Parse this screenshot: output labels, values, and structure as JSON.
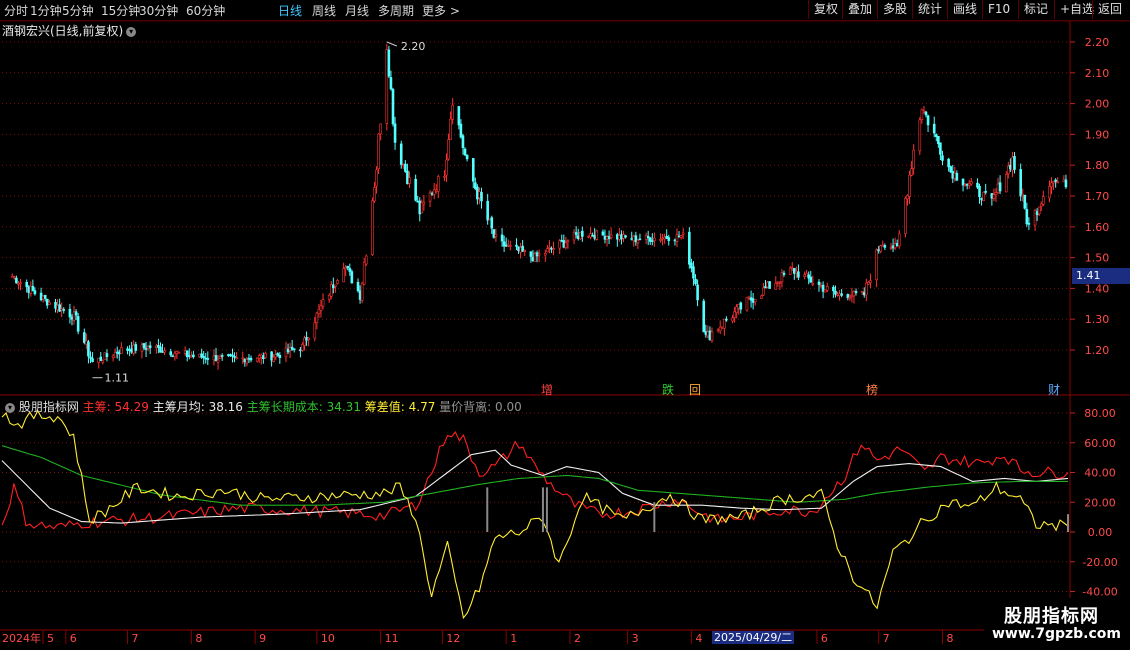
{
  "toolbar": {
    "periods": [
      "分时",
      "1分钟",
      "5分钟",
      "15分钟",
      "30分钟",
      "60分钟",
      "日线",
      "周线",
      "月线",
      "多周期",
      "更多 >"
    ],
    "active": "日线",
    "right_buttons": [
      "复权",
      "叠加",
      "多股",
      "统计",
      "画线",
      "F10",
      "标记",
      "+自选",
      "返回"
    ]
  },
  "main": {
    "title": "酒钢宏兴(日线,前复权)",
    "price_axis": [
      "2.20",
      "2.10",
      "2.00",
      "1.90",
      "1.80",
      "1.70",
      "1.60",
      "1.50",
      "1.40",
      "1.30",
      "1.20"
    ],
    "current_price": "1.41",
    "high_label": "2.20",
    "low_label": "1.11",
    "events": [
      {
        "text": "增",
        "color": "#ff4040"
      },
      {
        "text": "跌",
        "color": "#30d030"
      },
      {
        "text": "回",
        "color": "#ffaa33"
      },
      {
        "text": "榜",
        "color": "#ff8040"
      },
      {
        "text": "财",
        "color": "#5aaaff"
      }
    ]
  },
  "indicator": {
    "name": "股朋指标网",
    "items": [
      {
        "label": "主筹: 54.29",
        "color": "#ff3030"
      },
      {
        "label": "主筹月均: 38.16",
        "color": "#e8e8e8"
      },
      {
        "label": "主筹长期成本: 34.31",
        "color": "#30c030"
      },
      {
        "label": "筹差值: 4.77",
        "color": "#ffee33"
      },
      {
        "label": "量价背离: 0.00",
        "color": "#909090"
      }
    ],
    "axis": [
      "80.00",
      "60.00",
      "40.00",
      "20.00",
      "0.00",
      "-20.00",
      "-40.00"
    ]
  },
  "dates": {
    "year_label": "2024年",
    "months": [
      "5",
      "6",
      "7",
      "8",
      "9",
      "10",
      "11",
      "12",
      "1",
      "2",
      "3",
      "4",
      "5",
      "6",
      "7",
      "8",
      "9"
    ],
    "cursor_date": "2025/04/29/二"
  },
  "watermark": {
    "title": "股朋指标网",
    "url": "www.7gpzb.com"
  },
  "chart_data": {
    "type": "candlestick",
    "title": "酒钢宏兴(日线,前复权)",
    "ylim": [
      1.11,
      2.24
    ],
    "y_ticks": [
      1.2,
      1.3,
      1.4,
      1.5,
      1.6,
      1.7,
      1.8,
      1.9,
      2.0,
      2.1,
      2.2
    ],
    "close_path": [
      {
        "x": "2024-05-06",
        "y": 1.44
      },
      {
        "x": "2024-05-20",
        "y": 1.37
      },
      {
        "x": "2024-06-05",
        "y": 1.31
      },
      {
        "x": "2024-06-14",
        "y": 1.16
      },
      {
        "x": "2024-06-28",
        "y": 1.2
      },
      {
        "x": "2024-07-12",
        "y": 1.21
      },
      {
        "x": "2024-08-01",
        "y": 1.18
      },
      {
        "x": "2024-08-20",
        "y": 1.17
      },
      {
        "x": "2024-09-10",
        "y": 1.18
      },
      {
        "x": "2024-09-24",
        "y": 1.21
      },
      {
        "x": "2024-09-30",
        "y": 1.3
      },
      {
        "x": "2024-10-08",
        "y": 1.4
      },
      {
        "x": "2024-10-14",
        "y": 1.48
      },
      {
        "x": "2024-10-22",
        "y": 1.38
      },
      {
        "x": "2024-10-30",
        "y": 1.8
      },
      {
        "x": "2024-11-04",
        "y": 2.2
      },
      {
        "x": "2024-11-08",
        "y": 1.88
      },
      {
        "x": "2024-11-20",
        "y": 1.65
      },
      {
        "x": "2024-12-02",
        "y": 1.78
      },
      {
        "x": "2024-12-06",
        "y": 2.02
      },
      {
        "x": "2024-12-13",
        "y": 1.8
      },
      {
        "x": "2024-12-27",
        "y": 1.55
      },
      {
        "x": "2025-01-15",
        "y": 1.5
      },
      {
        "x": "2025-02-07",
        "y": 1.58
      },
      {
        "x": "2025-03-05",
        "y": 1.56
      },
      {
        "x": "2025-03-28",
        "y": 1.57
      },
      {
        "x": "2025-04-03",
        "y": 1.42
      },
      {
        "x": "2025-04-08",
        "y": 1.24
      },
      {
        "x": "2025-04-29",
        "y": 1.36
      },
      {
        "x": "2025-05-20",
        "y": 1.46
      },
      {
        "x": "2025-06-10",
        "y": 1.38
      },
      {
        "x": "2025-06-24",
        "y": 1.38
      },
      {
        "x": "2025-07-02",
        "y": 1.55
      },
      {
        "x": "2025-07-10",
        "y": 1.53
      },
      {
        "x": "2025-07-18",
        "y": 1.85
      },
      {
        "x": "2025-07-22",
        "y": 1.99
      },
      {
        "x": "2025-08-05",
        "y": 1.78
      },
      {
        "x": "2025-08-25",
        "y": 1.68
      },
      {
        "x": "2025-09-04",
        "y": 1.82
      },
      {
        "x": "2025-09-12",
        "y": 1.6
      },
      {
        "x": "2025-09-22",
        "y": 1.75
      },
      {
        "x": "2025-09-30",
        "y": 1.74
      }
    ],
    "high": {
      "date": "2024-11-04",
      "value": 2.2
    },
    "low": {
      "date": "2024-06-14",
      "value": 1.11
    },
    "indicator": {
      "ylim": [
        -60,
        95
      ],
      "series": [
        {
          "name": "主筹",
          "color": "#ff2020",
          "values": [
            [
              0,
              5
            ],
            [
              3,
              30
            ],
            [
              6,
              8
            ],
            [
              8,
              5
            ],
            [
              14,
              3
            ],
            [
              20,
              6
            ],
            [
              40,
              10
            ],
            [
              60,
              16
            ],
            [
              80,
              14
            ],
            [
              96,
              11
            ],
            [
              104,
              18
            ],
            [
              108,
              40
            ],
            [
              112,
              68
            ],
            [
              116,
              62
            ],
            [
              120,
              40
            ],
            [
              124,
              44
            ],
            [
              130,
              60
            ],
            [
              134,
              44
            ],
            [
              138,
              32
            ],
            [
              144,
              18
            ],
            [
              150,
              12
            ],
            [
              158,
              14
            ],
            [
              170,
              22
            ],
            [
              176,
              12
            ],
            [
              180,
              8
            ],
            [
              186,
              10
            ],
            [
              196,
              15
            ],
            [
              204,
              14
            ],
            [
              212,
              38
            ],
            [
              216,
              60
            ],
            [
              220,
              48
            ],
            [
              226,
              56
            ],
            [
              232,
              40
            ],
            [
              236,
              50
            ],
            [
              246,
              46
            ],
            [
              252,
              52
            ],
            [
              256,
              42
            ],
            [
              260,
              40
            ],
            [
              268,
              40
            ]
          ]
        },
        {
          "name": "主筹月均",
          "color": "#f0f0f0",
          "values": [
            [
              0,
              48
            ],
            [
              6,
              32
            ],
            [
              12,
              16
            ],
            [
              20,
              7
            ],
            [
              30,
              6
            ],
            [
              50,
              10
            ],
            [
              70,
              12
            ],
            [
              90,
              15
            ],
            [
              104,
              24
            ],
            [
              112,
              40
            ],
            [
              118,
              52
            ],
            [
              124,
              55
            ],
            [
              128,
              45
            ],
            [
              136,
              38
            ],
            [
              142,
              44
            ],
            [
              150,
              40
            ],
            [
              156,
              26
            ],
            [
              164,
              18
            ],
            [
              176,
              18
            ],
            [
              186,
              16
            ],
            [
              196,
              15
            ],
            [
              206,
              16
            ],
            [
              214,
              34
            ],
            [
              220,
              44
            ],
            [
              228,
              46
            ],
            [
              236,
              44
            ],
            [
              244,
              34
            ],
            [
              252,
              36
            ],
            [
              260,
              34
            ],
            [
              268,
              36
            ]
          ]
        },
        {
          "name": "主筹长期成本",
          "color": "#20b020",
          "values": [
            [
              0,
              58
            ],
            [
              10,
              50
            ],
            [
              20,
              38
            ],
            [
              40,
              25
            ],
            [
              60,
              18
            ],
            [
              80,
              18
            ],
            [
              96,
              20
            ],
            [
              108,
              26
            ],
            [
              120,
              32
            ],
            [
              130,
              36
            ],
            [
              142,
              38
            ],
            [
              150,
              36
            ],
            [
              160,
              28
            ],
            [
              180,
              24
            ],
            [
              200,
              20
            ],
            [
              212,
              22
            ],
            [
              220,
              26
            ],
            [
              232,
              30
            ],
            [
              244,
              33
            ],
            [
              256,
              34
            ],
            [
              268,
              34
            ]
          ]
        },
        {
          "name": "筹差值",
          "color": "#ffee33",
          "values": [
            [
              0,
              80
            ],
            [
              4,
              72
            ],
            [
              8,
              78
            ],
            [
              14,
              78
            ],
            [
              18,
              64
            ],
            [
              22,
              8
            ],
            [
              26,
              14
            ],
            [
              34,
              30
            ],
            [
              44,
              24
            ],
            [
              56,
              28
            ],
            [
              66,
              22
            ],
            [
              80,
              24
            ],
            [
              96,
              26
            ],
            [
              100,
              30
            ],
            [
              104,
              10
            ],
            [
              108,
              -42
            ],
            [
              112,
              -10
            ],
            [
              116,
              -58
            ],
            [
              120,
              -38
            ],
            [
              124,
              -4
            ],
            [
              130,
              0
            ],
            [
              136,
              10
            ],
            [
              140,
              -22
            ],
            [
              146,
              24
            ],
            [
              156,
              8
            ],
            [
              168,
              25
            ],
            [
              176,
              8
            ],
            [
              186,
              10
            ],
            [
              196,
              22
            ],
            [
              206,
              25
            ],
            [
              210,
              -8
            ],
            [
              214,
              -30
            ],
            [
              220,
              -50
            ],
            [
              224,
              -14
            ],
            [
              228,
              -4
            ],
            [
              232,
              8
            ],
            [
              238,
              20
            ],
            [
              244,
              17
            ],
            [
              250,
              30
            ],
            [
              256,
              22
            ],
            [
              260,
              5
            ],
            [
              268,
              4
            ]
          ]
        },
        {
          "name": "量价背离",
          "color": "#888888",
          "bars": [
            [
              122,
              30
            ],
            [
              136,
              30
            ],
            [
              137,
              30
            ],
            [
              164,
              20
            ],
            [
              268,
              12
            ]
          ]
        }
      ]
    }
  }
}
